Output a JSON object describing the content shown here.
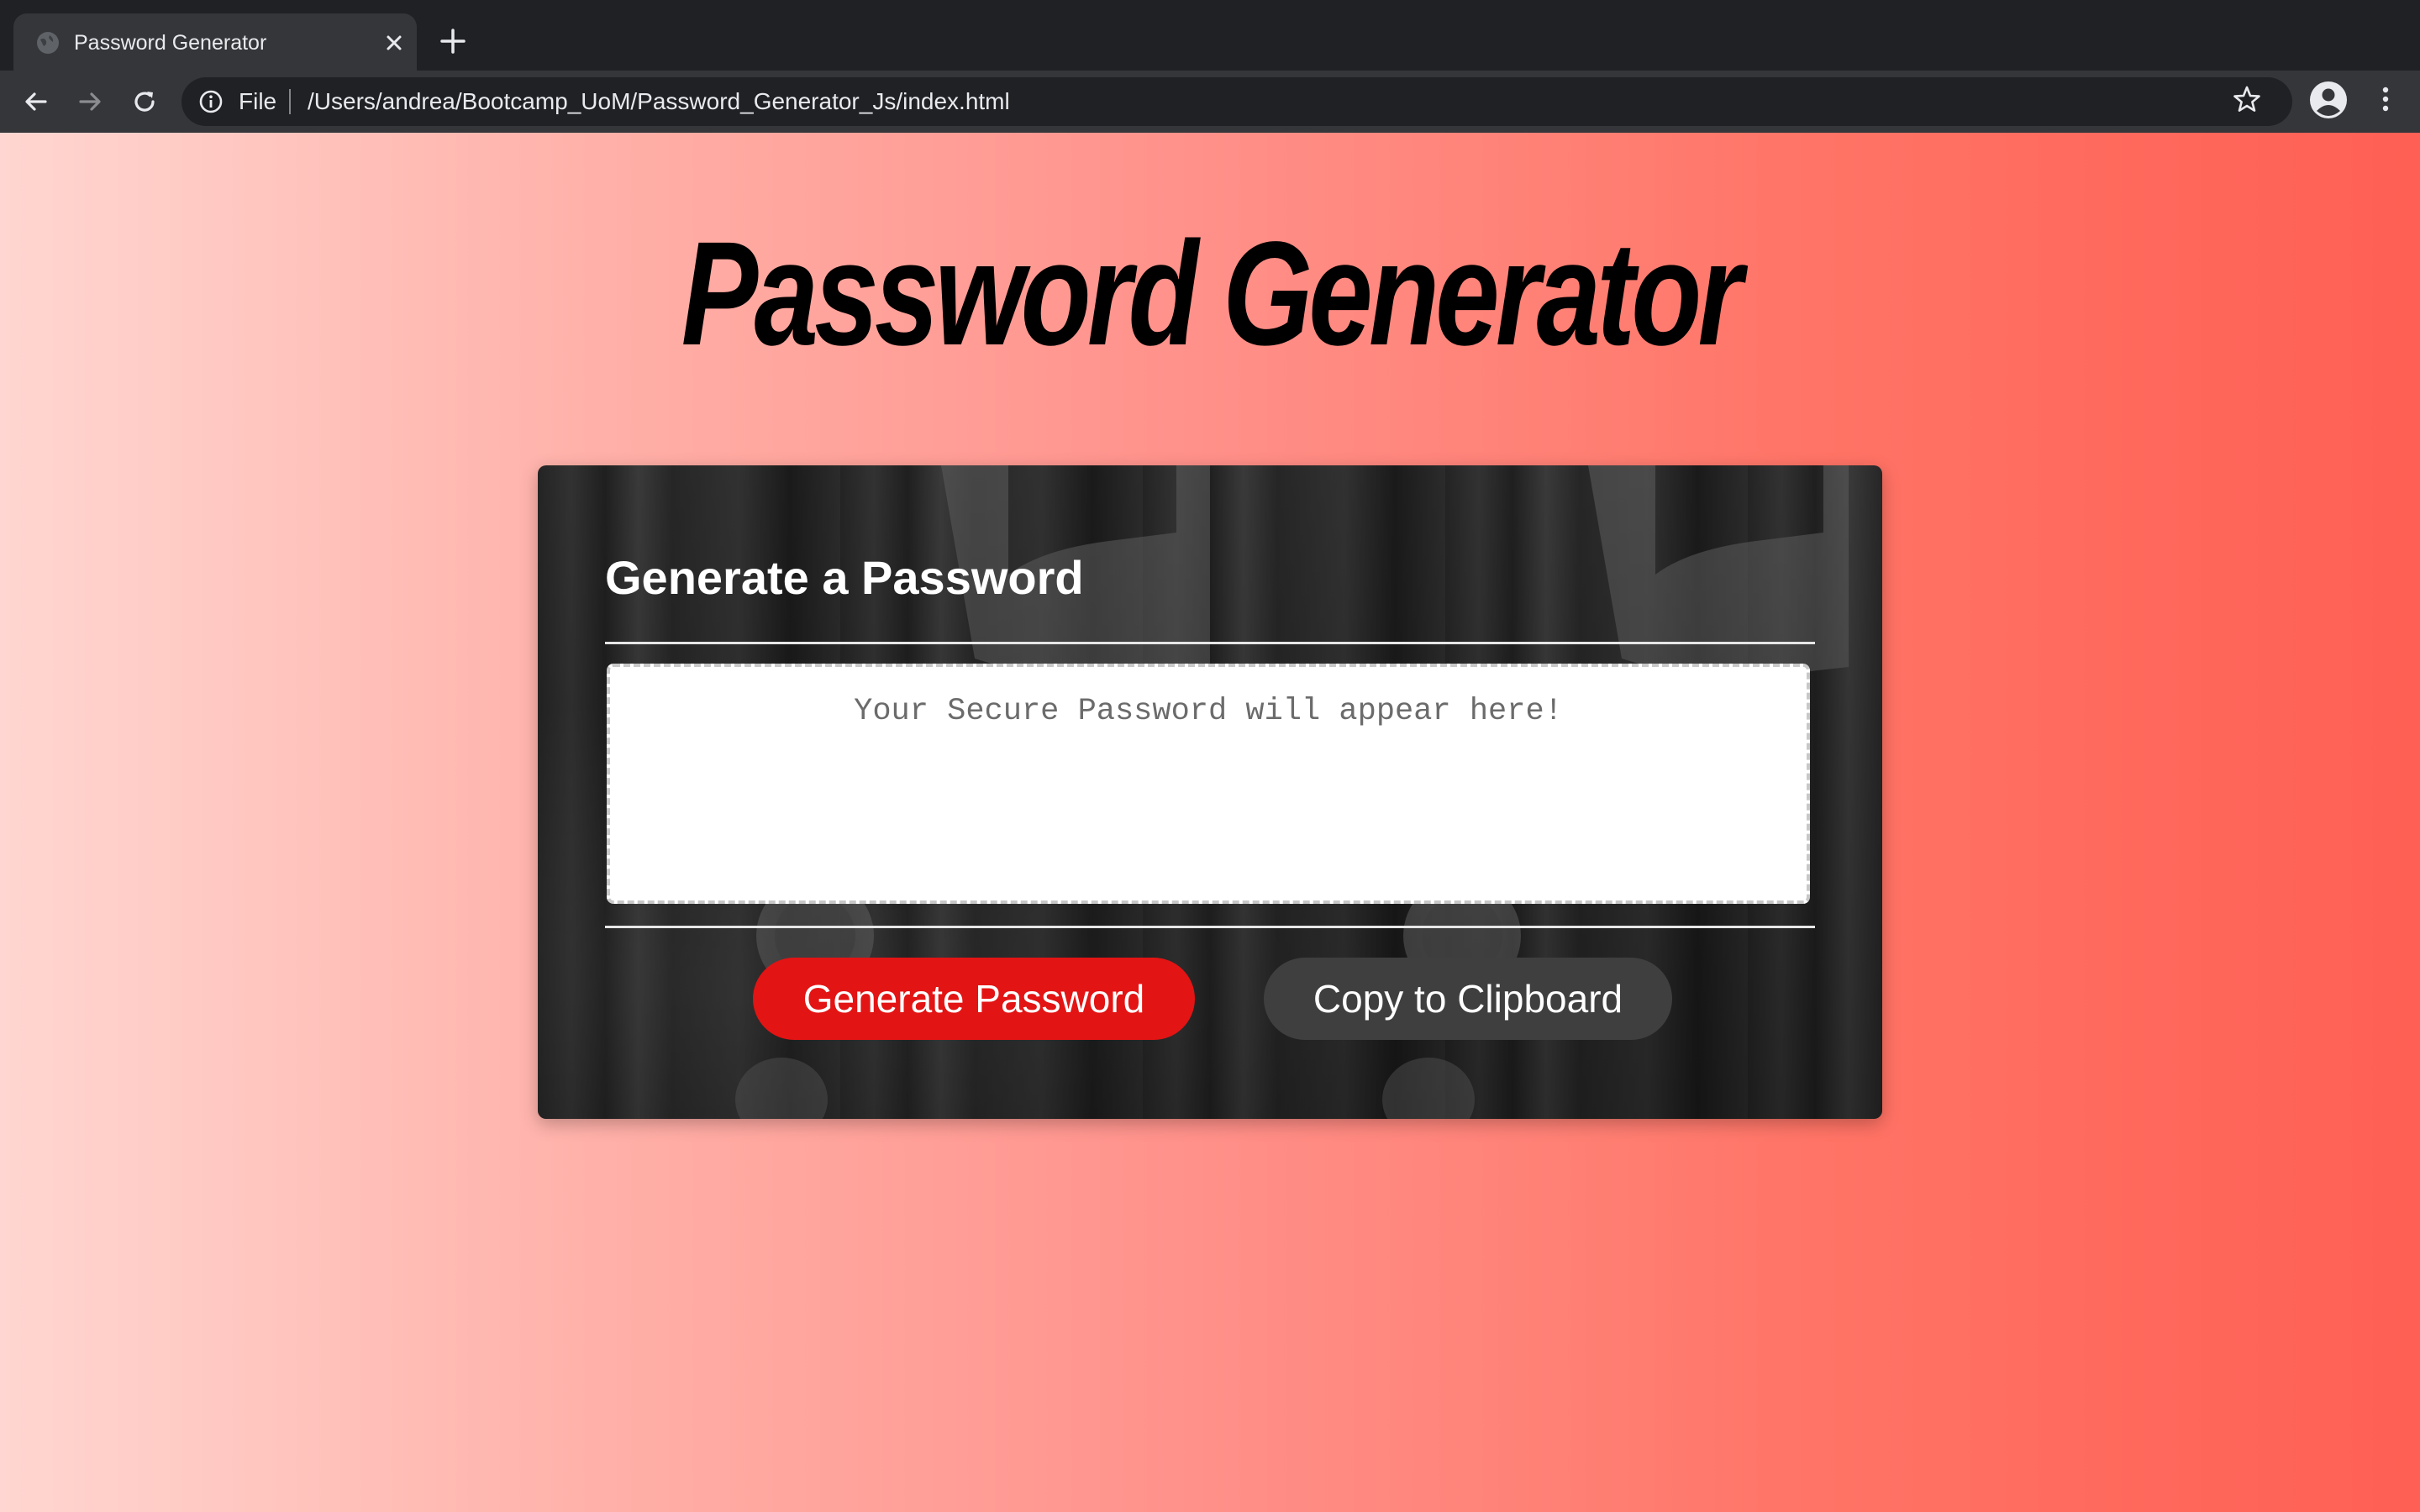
{
  "browser": {
    "tab": {
      "title": "Password Generator",
      "favicon": "globe-icon"
    },
    "new_tab_icon": "plus-icon",
    "address": {
      "scheme_label": "File",
      "url": "/Users/andrea/Bootcamp_UoM/Password_Generator_Js/index.html"
    },
    "toolbar_icons": [
      "back-arrow-icon",
      "forward-arrow-icon",
      "reload-icon",
      "info-icon",
      "star-icon",
      "profile-icon",
      "menu-icon"
    ]
  },
  "page": {
    "title": "Password Generator",
    "card": {
      "heading": "Generate a Password",
      "password_placeholder": "Your Secure Password will appear here!",
      "password_value": "",
      "generate_label": "Generate Password",
      "copy_label": "Copy to Clipboard"
    }
  },
  "colors": {
    "background_gradient_start": "#ffd6d1",
    "background_gradient_end": "#ff5f54",
    "generate_button": "#e31414",
    "copy_button": "#3f3f3f"
  }
}
